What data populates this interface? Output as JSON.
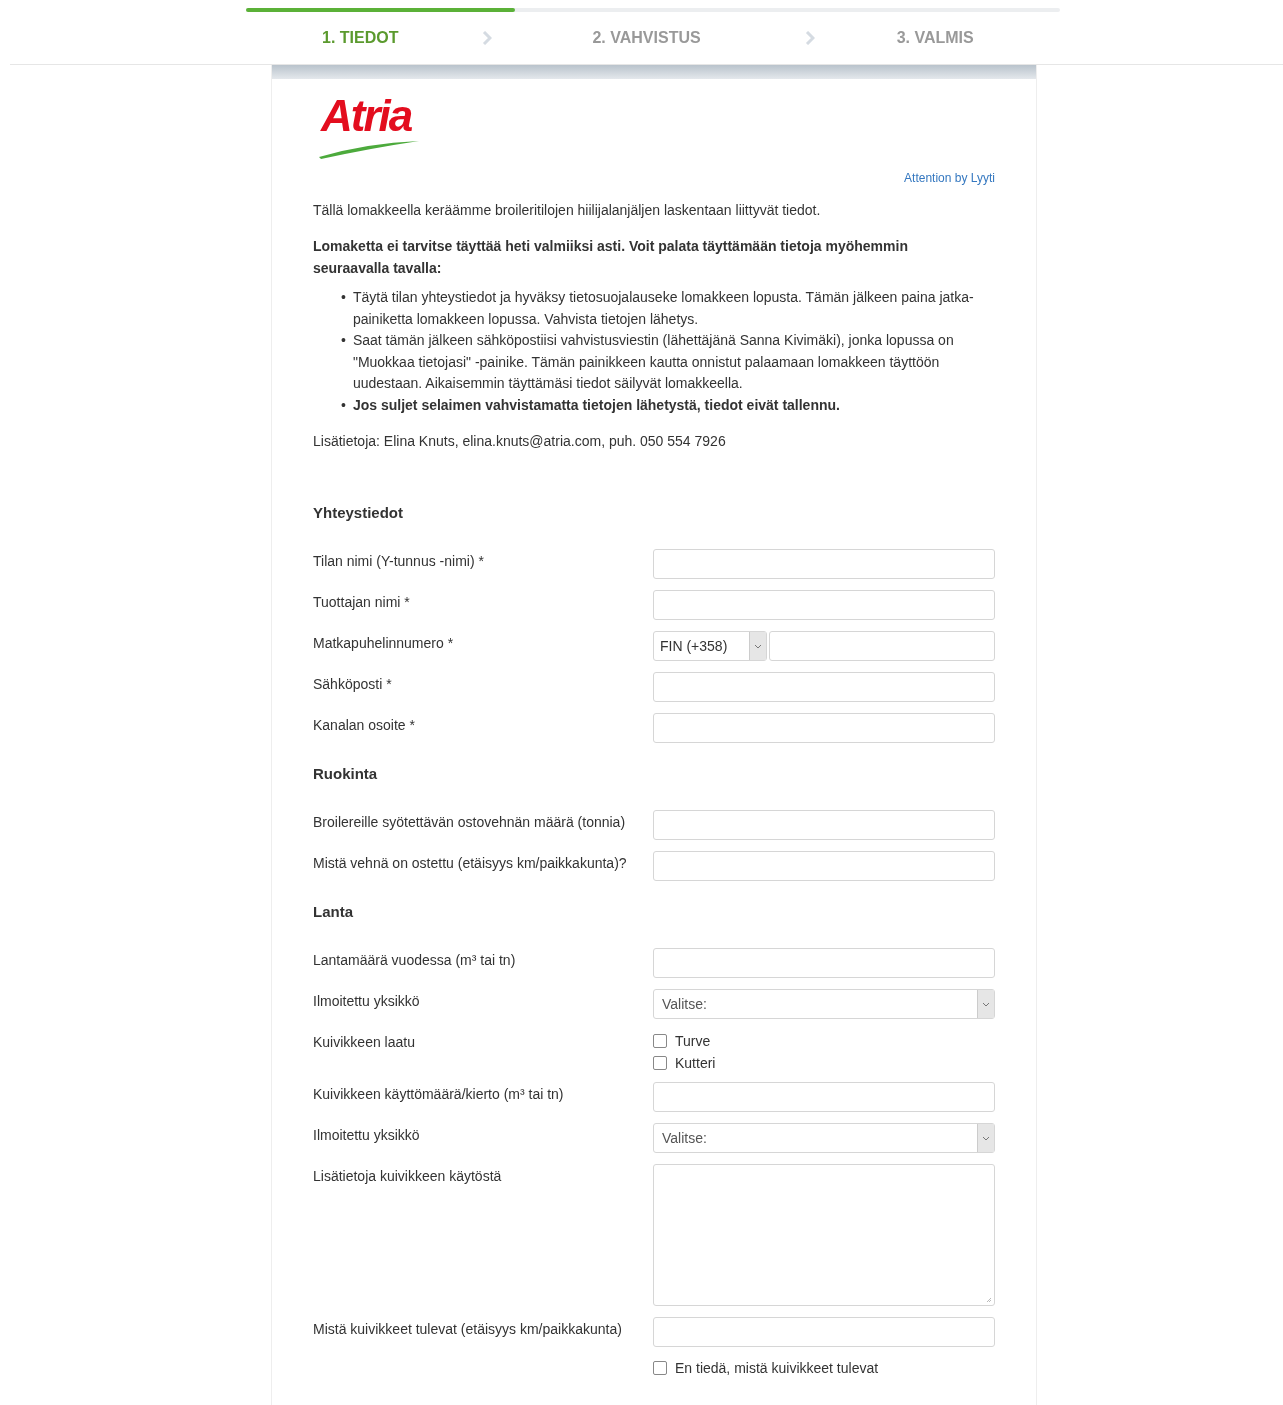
{
  "progress": {
    "level": 0.33
  },
  "steps": [
    {
      "label": "1. TIEDOT",
      "selected": true
    },
    {
      "label": "2. VAHVISTUS",
      "selected": false
    },
    {
      "label": "3. VALMIS",
      "selected": false
    }
  ],
  "logo": {
    "text": "Atria"
  },
  "attribution": "Attention by Lyyti",
  "intro": "Tällä lomakkeella keräämme broileritilojen hiilijalanjäljen laskentaan liittyvät tiedot.",
  "notice": "Lomaketta ei tarvitse täyttää heti valmiiksi asti. Voit palata täyttämään tietoja myöhemmin seuraavalla tavalla:",
  "steps_list": [
    {
      "marker": "•",
      "text": "Täytä tilan yhteystiedot ja hyväksy tietosuojalauseke lomakkeen lopusta. Tämän jälkeen paina jatka-painiketta lomakkeen lopussa. Vahvista tietojen lähetys.",
      "bold": false
    },
    {
      "marker": "•",
      "text": "Saat tämän jälkeen sähköpostiisi vahvistusviestin (lähettäjänä Sanna Kivimäki), jonka lopussa on \"Muokkaa tietojasi\" -painike. Tämän painikkeen kautta onnistut palaamaan lomakkeen täyttöön uudestaan. Aikaisemmin täyttämäsi tiedot säilyvät lomakkeella.",
      "bold": false
    },
    {
      "marker": "•",
      "text": "Jos suljet selaimen vahvistamatta tietojen lähetystä, tiedot eivät tallennu.",
      "bold": true
    }
  ],
  "contact": "Lisätietoja: Elina Knuts, elina.knuts@atria.com, puh. 050 554 7926",
  "sections": [
    {
      "title": "Yhteystiedot",
      "fields": [
        {
          "label": "Tilan nimi (Y-tunnus -nimi) *",
          "kind": "text"
        },
        {
          "label": "Tuottajan nimi *",
          "kind": "text"
        },
        {
          "label": "Matkapuhelinnumero *",
          "kind": "phone",
          "value": "FIN (+358)"
        },
        {
          "label": "Sähköposti *",
          "kind": "text"
        },
        {
          "label": "Kanalan osoite *",
          "kind": "text"
        }
      ]
    },
    {
      "title": "Ruokinta",
      "fields": [
        {
          "label": "Broilereille syötettävän ostovehnän määrä (tonnia)",
          "kind": "text"
        },
        {
          "label": "Mistä vehnä on ostettu (etäisyys km/paikkakunta)?",
          "kind": "text"
        }
      ]
    },
    {
      "title": "Lanta",
      "fields": [
        {
          "label": "Lantamäärä vuodessa (m³ tai tn)",
          "kind": "text"
        },
        {
          "label": "Ilmoitettu yksikkö",
          "kind": "select",
          "value": "Valitse:"
        },
        {
          "label": "Kuivikkeen laatu",
          "kind": "checkboxes",
          "options": [
            {
              "label": "Turve",
              "checked": false
            },
            {
              "label": "Kutteri",
              "checked": false
            }
          ]
        },
        {
          "label": "Kuivikkeen käyttömäärä/kierto (m³ tai tn)",
          "kind": "text"
        },
        {
          "label": "Ilmoitettu yksikkö",
          "kind": "select",
          "value": "Valitse:"
        },
        {
          "label": "Lisätietoja kuivikkeen käytöstä",
          "kind": "textarea"
        },
        {
          "label": "Mistä kuivikkeet tulevat (etäisyys km/paikkakunta)",
          "kind": "text",
          "options": [
            {
              "label": "En tiedä, mistä kuivikkeet tulevat",
              "checked": false
            }
          ]
        }
      ]
    }
  ]
}
